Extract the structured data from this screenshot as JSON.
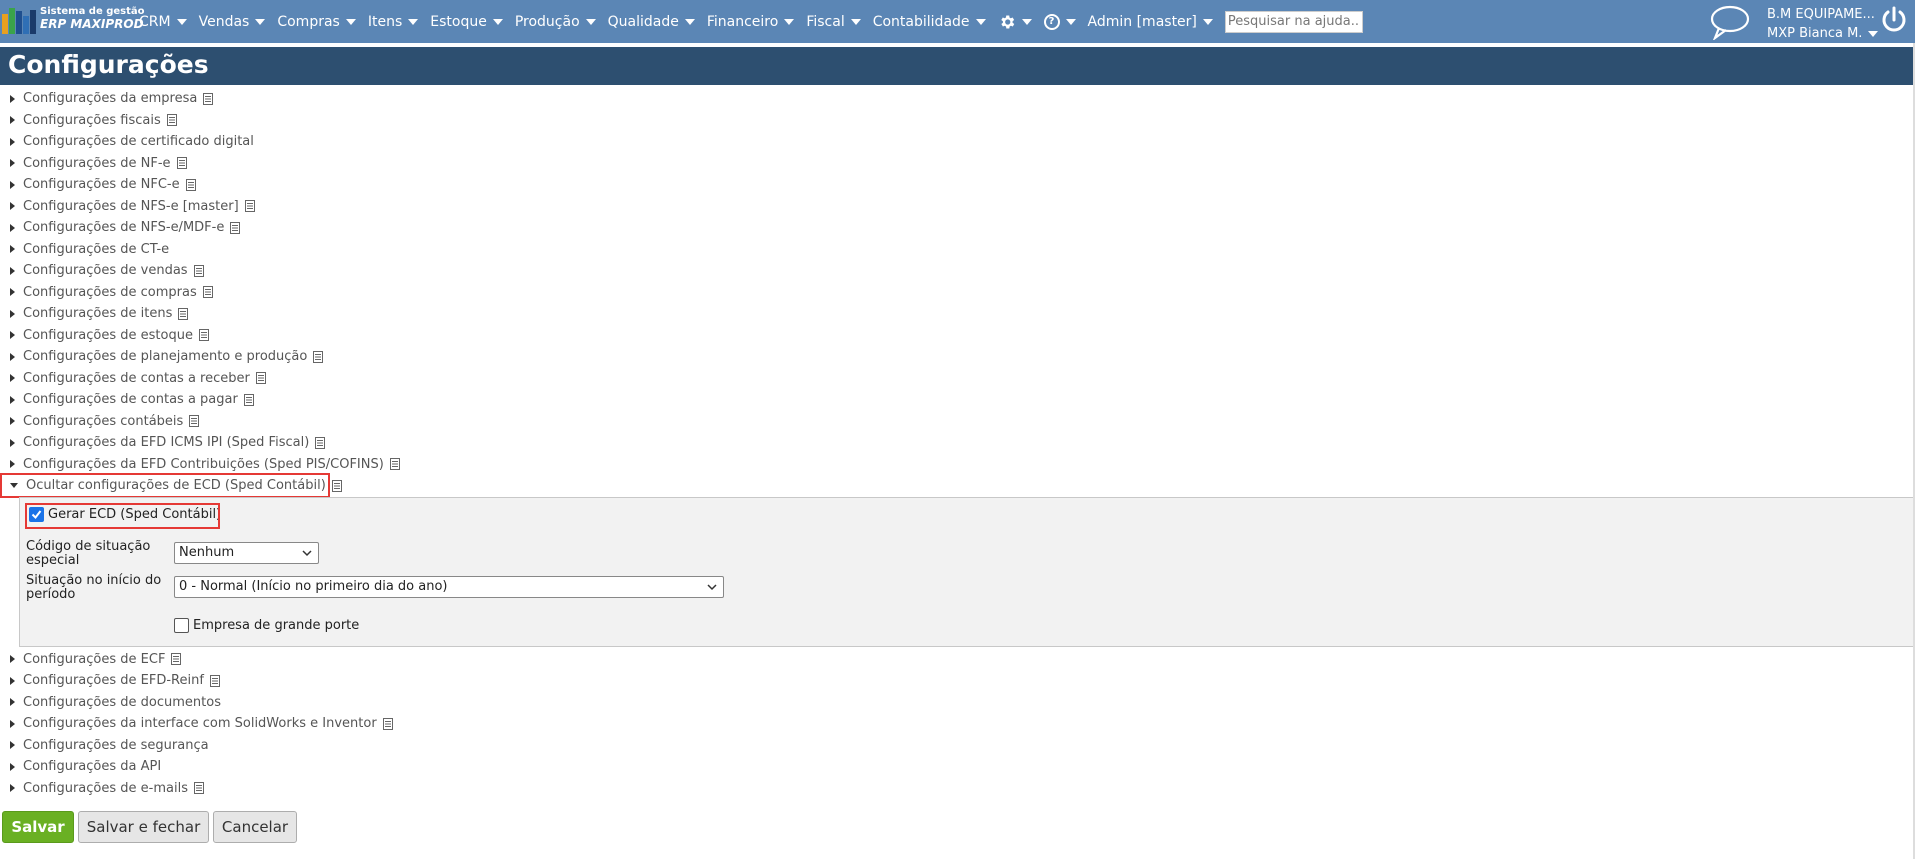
{
  "header": {
    "logo_line1": "Sistema de gestão",
    "logo_line2": "ERP MAXIPROD",
    "menu": [
      "CRM",
      "Vendas",
      "Compras",
      "Itens",
      "Estoque",
      "Produção",
      "Qualidade",
      "Financeiro",
      "Fiscal",
      "Contabilidade"
    ],
    "user_menu": "Admin [master]",
    "search_placeholder": "Pesquisar na ajuda...",
    "company_name": "B.M EQUIPAME...",
    "company_user": "MXP Bianca M.",
    "help_symbol": "?"
  },
  "page": {
    "title": "Configurações"
  },
  "sections_before": [
    {
      "label": "Configurações da empresa",
      "doc": true
    },
    {
      "label": "Configurações fiscais",
      "doc": true
    },
    {
      "label": "Configurações de certificado digital",
      "doc": false
    },
    {
      "label": "Configurações de NF-e",
      "doc": true
    },
    {
      "label": "Configurações de NFC-e",
      "doc": true
    },
    {
      "label": "Configurações de NFS-e [master]",
      "doc": true
    },
    {
      "label": "Configurações de NFS-e/MDF-e",
      "doc": true
    },
    {
      "label": "Configurações de CT-e",
      "doc": false
    },
    {
      "label": "Configurações de vendas",
      "doc": true
    },
    {
      "label": "Configurações de compras",
      "doc": true
    },
    {
      "label": "Configurações de itens",
      "doc": true
    },
    {
      "label": "Configurações de estoque",
      "doc": true
    },
    {
      "label": "Configurações de planejamento e produção",
      "doc": true
    },
    {
      "label": "Configurações de contas a receber",
      "doc": true
    },
    {
      "label": "Configurações de contas a pagar",
      "doc": true
    },
    {
      "label": "Configurações contábeis",
      "doc": true
    },
    {
      "label": "Configurações da EFD ICMS IPI (Sped Fiscal)",
      "doc": true
    },
    {
      "label": "Configurações da EFD Contribuições (Sped PIS/COFINS)",
      "doc": true
    }
  ],
  "expanded": {
    "label": "Ocultar configurações de ECD (Sped Contábil)",
    "gerar_ecd": "Gerar ECD (Sped Contábil)",
    "codigo_label": "Código de situação especial",
    "codigo_value": "Nenhum",
    "situacao_label": "Situação no início do período",
    "situacao_value": "0 - Normal (Início no primeiro dia do ano)",
    "grande_porte": "Empresa de grande porte"
  },
  "sections_after": [
    {
      "label": "Configurações de ECF",
      "doc": true
    },
    {
      "label": "Configurações de EFD-Reinf",
      "doc": true
    },
    {
      "label": "Configurações de documentos",
      "doc": false
    },
    {
      "label": "Configurações da interface com SolidWorks e Inventor",
      "doc": true
    },
    {
      "label": "Configurações de segurança",
      "doc": false
    },
    {
      "label": "Configurações da API",
      "doc": false
    },
    {
      "label": "Configurações de e-mails",
      "doc": true
    }
  ],
  "buttons": {
    "save": "Salvar",
    "save_close": "Salvar e fechar",
    "cancel": "Cancelar"
  },
  "colors": {
    "topbar": "#5b86b5",
    "titlebar": "#2d4f70",
    "primary_button": "#6ab023",
    "highlight": "#e53935",
    "checkbox": "#1a73e8"
  }
}
